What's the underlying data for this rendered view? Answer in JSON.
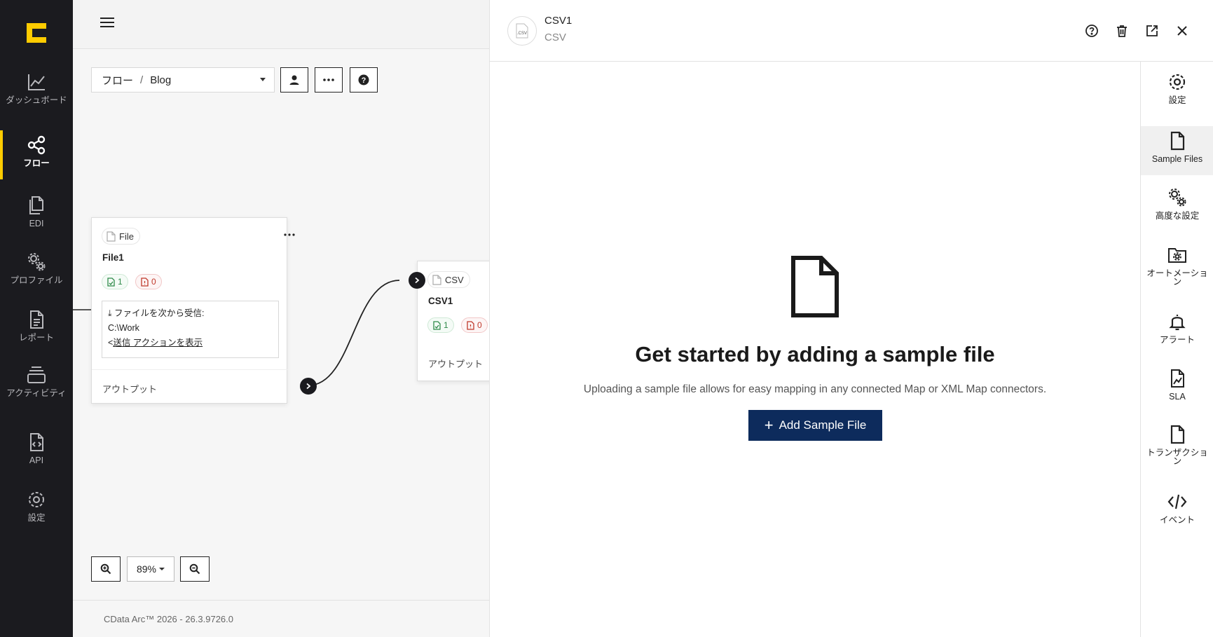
{
  "nav": {
    "logo": "cdata-logo-icon",
    "items": [
      {
        "label": "ダッシュボード",
        "icon": "chart-line-icon"
      },
      {
        "label": "フロー",
        "icon": "share-nodes-icon",
        "active": true
      },
      {
        "label": "EDI",
        "icon": "documents-icon"
      },
      {
        "label": "プロファイル",
        "icon": "cogs-icon"
      },
      {
        "label": "レポート",
        "icon": "report-icon"
      },
      {
        "label": "アクティビティ",
        "icon": "layers-icon"
      },
      {
        "label": "API",
        "icon": "api-file-icon"
      },
      {
        "label": "設定",
        "icon": "gear-icon"
      }
    ]
  },
  "canvas": {
    "breadcrumb": {
      "root": "フロー",
      "separator": "/",
      "current": "Blog"
    },
    "nodes": [
      {
        "type": "File",
        "name": "File1",
        "success_count": "1",
        "error_count": "0",
        "receive_label": "ファイルを次から受信:",
        "receive_path": "C:\\Work",
        "send_link": "送信 アクションを表示",
        "output_label": "アウトプット"
      },
      {
        "type": "CSV",
        "name": "CSV1",
        "success_count": "1",
        "error_count": "0",
        "output_label": "アウトプット"
      }
    ],
    "zoom": "89%",
    "footer": "CData Arc™ 2026 - 26.3.9726.0"
  },
  "panel": {
    "title": "CSV1",
    "subtitle": "CSV",
    "avatar_text": ".CSV",
    "empty_title": "Get started by adding a sample file",
    "empty_text": "Uploading a sample file allows for easy mapping in any connected Map or XML Map connectors.",
    "add_button": "Add Sample File",
    "side_items": [
      {
        "label": "設定",
        "icon": "gear-icon"
      },
      {
        "label": "Sample Files",
        "icon": "file-icon",
        "active": true
      },
      {
        "label": "高度な設定",
        "icon": "cogs-icon"
      },
      {
        "label": "オートメーション",
        "icon": "folder-gear-icon"
      },
      {
        "label": "アラート",
        "icon": "bell-icon"
      },
      {
        "label": "SLA",
        "icon": "sla-file-icon"
      },
      {
        "label": "トランザクション",
        "icon": "file-icon"
      },
      {
        "label": "イベント",
        "icon": "code-icon"
      }
    ]
  },
  "colors": {
    "nav_bg": "#1b1b1f",
    "accent": "#ffcc00",
    "primary_button": "#0d2b5c",
    "success": "#2f8a4a",
    "error": "#c0392b"
  }
}
